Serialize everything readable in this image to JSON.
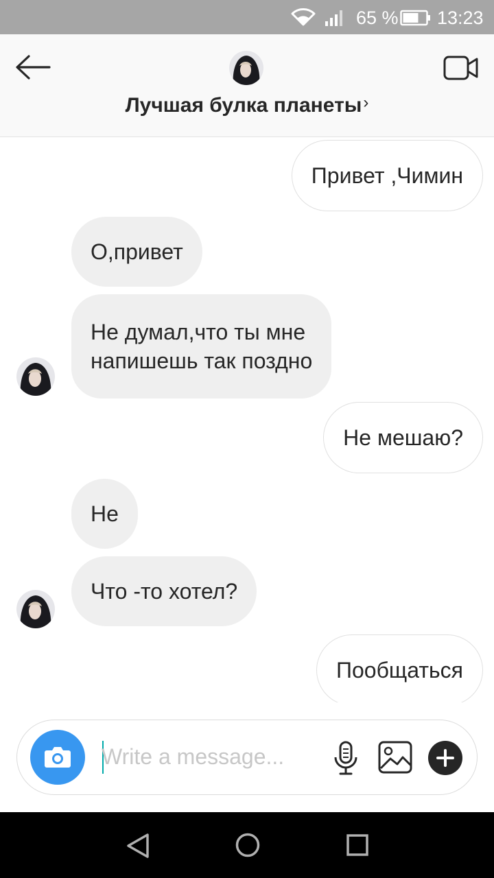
{
  "status_bar": {
    "battery_percent": "65 %",
    "time": "13:23",
    "icons": [
      "wifi-icon",
      "signal-icon",
      "battery-icon"
    ]
  },
  "header": {
    "title": "Лучшая булка планеты",
    "chevron": "›",
    "icons": [
      "back-arrow-icon",
      "avatar",
      "video-call-icon"
    ]
  },
  "messages": [
    {
      "direction": "outgoing",
      "text": "Привет ,Чимин"
    },
    {
      "direction": "incoming",
      "text": "О,привет"
    },
    {
      "direction": "incoming",
      "lines": [
        "Не думал,что ты мне",
        "напишешь так поздно"
      ]
    },
    {
      "direction": "outgoing",
      "text": "Не мешаю?"
    },
    {
      "direction": "incoming",
      "text": "Не"
    },
    {
      "direction": "incoming",
      "text": "Что -то хотел?"
    },
    {
      "direction": "outgoing",
      "text": "Пообщаться"
    }
  ],
  "composer": {
    "placeholder": "Write a message...",
    "value": "",
    "icons": [
      "camera-icon",
      "microphone-icon",
      "gallery-icon",
      "plus-icon"
    ]
  },
  "colors": {
    "accent": "#3897f0",
    "incoming_bubble": "#efefef",
    "outgoing_border": "#e0e0e0",
    "status_bar": "#a6a6a6",
    "nav_bar": "#000000"
  },
  "nav_bar": {
    "icons": [
      "nav-back-icon",
      "nav-home-icon",
      "nav-recents-icon"
    ]
  }
}
